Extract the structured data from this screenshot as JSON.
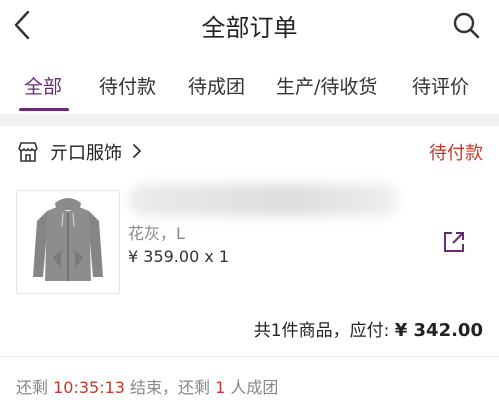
{
  "header": {
    "title": "全部订单",
    "back_icon": "chevron-left-icon",
    "search_icon": "search-icon"
  },
  "tabs": [
    {
      "label": "全部",
      "active": true
    },
    {
      "label": "待付款",
      "active": false
    },
    {
      "label": "待成团",
      "active": false
    },
    {
      "label": "生产/待收货",
      "active": false
    },
    {
      "label": "待评价",
      "active": false
    }
  ],
  "order": {
    "shop_name": "亓口服饰",
    "status": "待付款",
    "product": {
      "variant": "花灰，L",
      "price": "¥ 359.00",
      "quantity": "x 1"
    },
    "summary": {
      "prefix": "共1件商品，应付: ",
      "amount": "¥ 342.00"
    },
    "countdown": {
      "prefix": "还剩 ",
      "time": "10:35:13",
      "middle": " 结束，还剩 ",
      "count": "1",
      "suffix": " 人成团"
    }
  },
  "colors": {
    "accent": "#6b2a78",
    "status_red": "#c0392b"
  }
}
